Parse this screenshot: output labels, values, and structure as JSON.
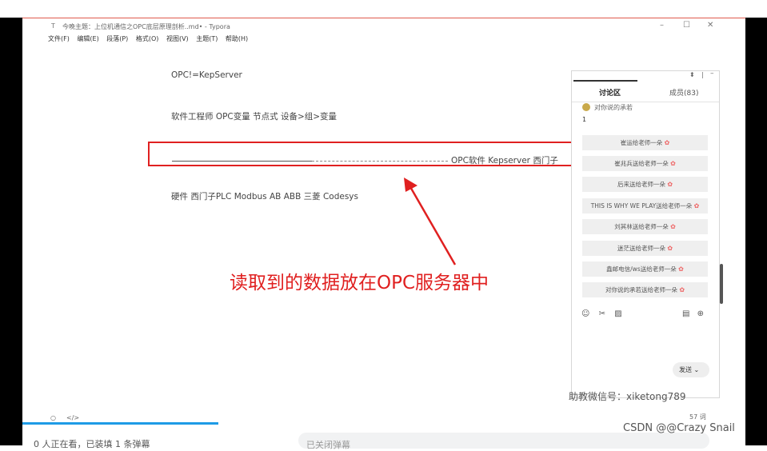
{
  "window": {
    "title": "今晚主题：上位机通信之OPC底层原理剖析..md• - Typora",
    "controls": {
      "minimize": "–",
      "maximize": "☐",
      "close": "✕"
    }
  },
  "menu": [
    "文件(F)",
    "编辑(E)",
    "段落(P)",
    "格式(O)",
    "视图(V)",
    "主题(T)",
    "帮助(H)"
  ],
  "document": {
    "line1": "OPC!=KepServer",
    "line2": "软件工程师    OPC变量  节点式    设备>组>变量",
    "line3_tail": "OPC软件   Kepserver  西门子",
    "line4": "硬件 西门子PLC    Modbus  AB  ABB  三菱  Codesys"
  },
  "annotation": {
    "text": "读取到的数据放在OPC服务器中",
    "color": "#e02020"
  },
  "chat": {
    "tab_active": "讨论区",
    "tab_members": "成员(83)",
    "user": "对你说的承若",
    "user_message": "1",
    "gifts": [
      "崔运给老师一朵",
      "崔兆兵送给老师一朵",
      "后来送给老师一朵",
      "THIS IS WHY WE PLAY送给老师一朵",
      "刘其林送给老师一朵",
      "迷茫送给老师一朵",
      "鑫邮电信/ws送给老师一朵",
      "对你说的承若送给老师一朵"
    ],
    "send_label": "发送 ⌄",
    "tools_left": [
      "☺",
      "✂",
      "▨"
    ],
    "tools_right": [
      "▤",
      "⊕"
    ]
  },
  "status": {
    "left_icons": [
      "○",
      "</>"
    ],
    "word_count": "57 词"
  },
  "overlay": {
    "assistant_wechat": "助教微信号：xiketong789",
    "csdn": "CSDN @@Crazy Snail",
    "bottom_text": "0 人正在看，已装填 1 条弹幕",
    "danmu_placeholder": "已关闭弹幕"
  },
  "colors": {
    "accent_red": "#e02020",
    "progress_blue": "#1e9be6"
  }
}
